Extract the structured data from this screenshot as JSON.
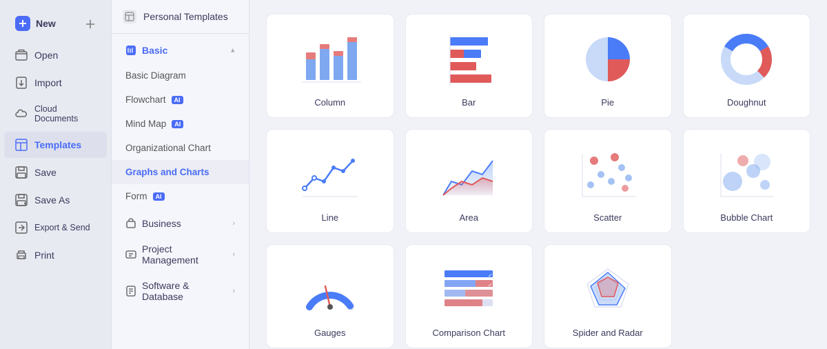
{
  "sidebar": {
    "items": [
      {
        "label": "New",
        "icon": "new-icon"
      },
      {
        "label": "Open",
        "icon": "open-icon"
      },
      {
        "label": "Import",
        "icon": "import-icon"
      },
      {
        "label": "Cloud Documents",
        "icon": "cloud-icon"
      },
      {
        "label": "Templates",
        "icon": "templates-icon"
      },
      {
        "label": "Save",
        "icon": "save-icon"
      },
      {
        "label": "Save As",
        "icon": "save-as-icon"
      },
      {
        "label": "Export & Send",
        "icon": "export-icon"
      },
      {
        "label": "Print",
        "icon": "print-icon"
      }
    ]
  },
  "mid_panel": {
    "personal_templates": "Personal Templates",
    "basic_section": "Basic",
    "items": [
      {
        "label": "Basic Diagram",
        "active": false
      },
      {
        "label": "Flowchart",
        "ai": true,
        "active": false
      },
      {
        "label": "Mind Map",
        "ai": true,
        "active": false
      },
      {
        "label": "Organizational Chart",
        "active": false
      },
      {
        "label": "Graphs and Charts",
        "active": true
      },
      {
        "label": "Form",
        "ai": true,
        "active": false
      }
    ],
    "categories": [
      {
        "label": "Business"
      },
      {
        "label": "Project Management"
      },
      {
        "label": "Software & Database"
      }
    ]
  },
  "charts": [
    {
      "label": "Column",
      "type": "column"
    },
    {
      "label": "Bar",
      "type": "bar"
    },
    {
      "label": "Pie",
      "type": "pie"
    },
    {
      "label": "Doughnut",
      "type": "doughnut"
    },
    {
      "label": "Line",
      "type": "line"
    },
    {
      "label": "Area",
      "type": "area"
    },
    {
      "label": "Scatter",
      "type": "scatter"
    },
    {
      "label": "Bubble Chart",
      "type": "bubble"
    },
    {
      "label": "Gauges",
      "type": "gauges"
    },
    {
      "label": "Comparison Chart",
      "type": "comparison"
    },
    {
      "label": "Spider and Radar",
      "type": "spider"
    }
  ]
}
